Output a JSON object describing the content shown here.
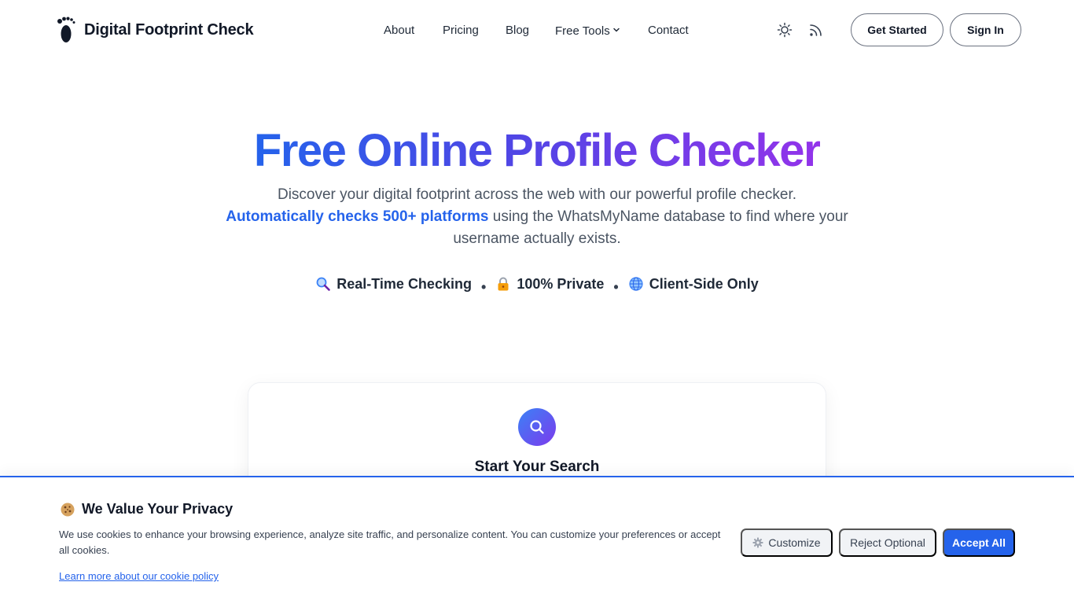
{
  "brand": {
    "name": "Digital Footprint Check",
    "logo_icon": "footprint-icon"
  },
  "nav": {
    "items": [
      {
        "label": "About"
      },
      {
        "label": "Pricing"
      },
      {
        "label": "Blog"
      },
      {
        "label": "Free Tools",
        "has_dropdown": true
      },
      {
        "label": "Contact"
      }
    ],
    "theme_icon": "sun-icon",
    "feed_icon": "rss-icon",
    "get_started_label": "Get Started",
    "sign_in_label": "Sign In"
  },
  "hero": {
    "title": "Free Online Profile Checker",
    "subtitle_line1": "Discover your digital footprint across the web with our powerful profile checker.",
    "subtitle_highlight": "Automatically checks 500+ platforms",
    "subtitle_rest": " using the WhatsMyName database to find where your username actually exists.",
    "features": [
      {
        "icon": "magnifier-icon",
        "label": "Real-Time Checking"
      },
      {
        "icon": "lock-icon",
        "label": "100% Private"
      },
      {
        "icon": "globe-icon",
        "label": "Client-Side Only"
      }
    ],
    "separator": "•"
  },
  "search_card": {
    "icon": "search-icon",
    "title": "Start Your Search"
  },
  "cookie_banner": {
    "icon": "cookie-icon",
    "title": "We Value Your Privacy",
    "text": "We use cookies to enhance your browsing experience, analyze site traffic, and personalize content. You can customize your preferences or accept all cookies.",
    "policy_link": "Learn more about our cookie policy",
    "customize_label": "Customize",
    "reject_label": "Reject Optional",
    "accept_label": "Accept All"
  },
  "colors": {
    "accent": "#2563eb",
    "gradient_start": "#2563eb",
    "gradient_end": "#9333ea"
  }
}
